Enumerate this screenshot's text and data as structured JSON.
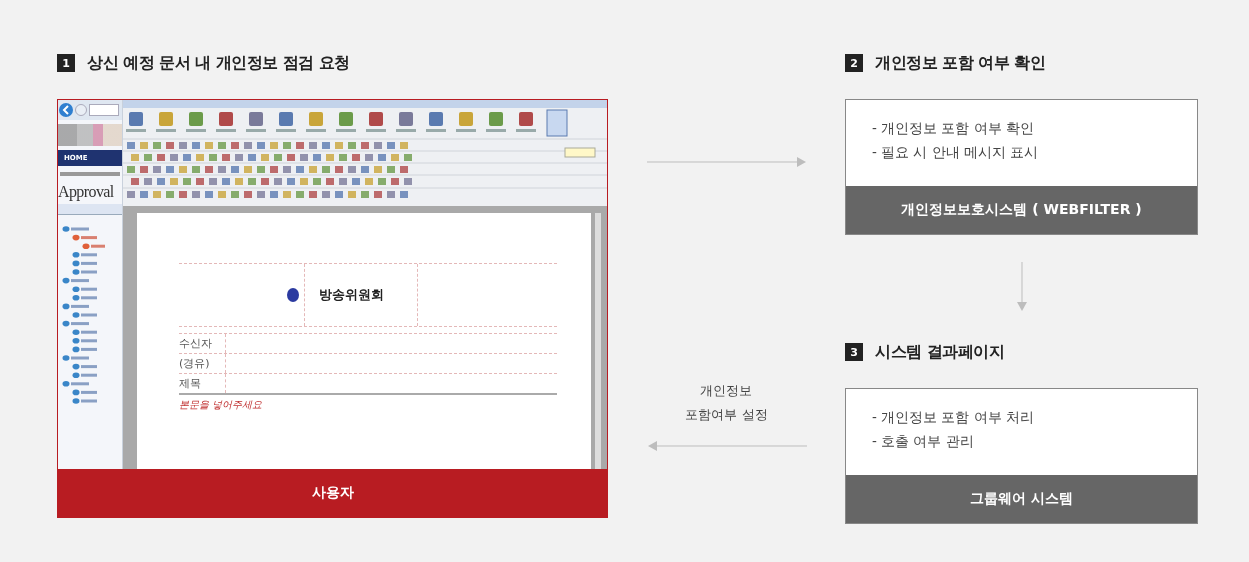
{
  "user_panel": {
    "number": "1",
    "title": "상신 예정 문서 내 개인정보 점검 요청",
    "footer": "사용자",
    "screenshot": {
      "nav_label": "HOME",
      "logo": "Approval",
      "document": {
        "org": "방송위원회",
        "fields": [
          "수신자",
          "(경유)",
          "제목"
        ],
        "body_text": "본문을 넣어주세요"
      }
    }
  },
  "flow_label": [
    "개인정보",
    "포함여부 설정"
  ],
  "systems": [
    {
      "number": "2",
      "title": "개인정보 포함 여부 확인",
      "lines": [
        "- 개인정보 포함 여부 확인",
        "- 필요 시 안내 메시지 표시"
      ],
      "footer": "개인정보보호시스템 ( WEBFILTER )"
    },
    {
      "number": "3",
      "title": "시스템 결과페이지",
      "lines": [
        "- 개인정보 포함 여부 처리",
        "- 호출 여부 관리"
      ],
      "footer": "그룹웨어 시스템"
    }
  ]
}
